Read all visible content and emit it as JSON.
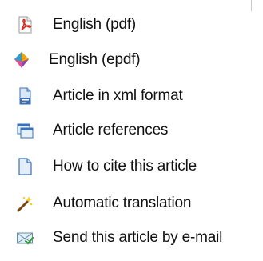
{
  "links": [
    {
      "id": "pdf",
      "label": "English (pdf)",
      "icon": "pdf-icon"
    },
    {
      "id": "epdf",
      "label": "English (epdf)",
      "icon": "epdf-icon"
    },
    {
      "id": "xml",
      "label": "Article in xml format",
      "icon": "xml-document-icon"
    },
    {
      "id": "refs",
      "label": "Article references",
      "icon": "references-window-icon"
    },
    {
      "id": "cite",
      "label": "How to cite this article",
      "icon": "document-icon"
    },
    {
      "id": "translate",
      "label": "Automatic translation",
      "icon": "magic-wand-icon"
    },
    {
      "id": "email",
      "label": "Send this article by e-mail",
      "icon": "envelope-icon"
    }
  ],
  "colors": {
    "pdf_red": "#d9261c",
    "doc_blue": "#3b6fb6",
    "envelope_green": "#3f9b3f"
  }
}
